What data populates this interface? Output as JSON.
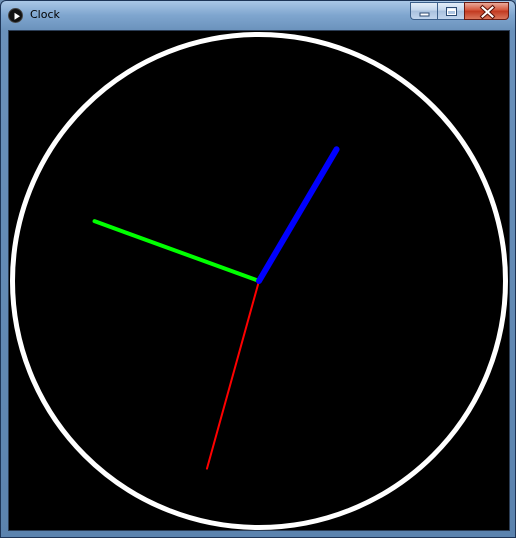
{
  "window": {
    "title": "Clock",
    "app_icon": "play-circle-icon",
    "controls": {
      "minimize_icon": "minimize-icon",
      "maximize_icon": "maximize-icon",
      "close_icon": "close-icon"
    }
  },
  "clock": {
    "background_color": "#000000",
    "face_color": "#ffffff",
    "hands": {
      "hour": {
        "color": "#0000ff",
        "length_fraction": 0.62,
        "angle_deg": 30.5
      },
      "minute": {
        "color": "#00ff00",
        "length_fraction": 0.71,
        "angle_deg": 290
      },
      "second": {
        "color": "#ff0000",
        "length_fraction": 0.79,
        "angle_deg": 195.5
      }
    }
  }
}
